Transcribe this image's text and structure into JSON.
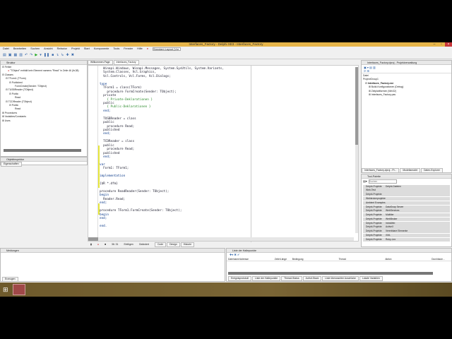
{
  "window": {
    "title": "Interfaces_Factory - Delphi XE3 - Interfaces_Factory"
  },
  "menu": [
    "Datei",
    "Bearbeiten",
    "Suchen",
    "Ansicht",
    "Refactor",
    "Projekt",
    "Start",
    "Komponente",
    "Tools",
    "Fenster",
    "Hilfe"
  ],
  "layout_select": "Standard-Layout (Vor",
  "structure": {
    "title": "Struktur",
    "items": [
      "Fehler",
      "\"TObject\" enthält kein Element namens \"Read\" in Zeile 46 (ltr,38)",
      "Classes",
      "TForm1 (TForm)",
      "Published",
      "FormCreate(Sender: TObject)",
      "TUSBReader (TObject)",
      "Public",
      "Read",
      "TCDReader (TObject)",
      "Public",
      "Read",
      "Procedures",
      "Variables/Constants",
      "Uses"
    ],
    "tab": "Objektinspektor",
    "bottom_tab": "Eigenschaften"
  },
  "editor": {
    "tabs": [
      "Willkommen-Page",
      "Interfaces_Factory"
    ],
    "lines": [
      "  Winapi.Windows, Winapi.Messages, System.SysUtils, System.Variants,",
      "  System.Classes, Vcl.Graphics,",
      "  Vcl.Controls, Vcl.Forms, Vcl.Dialogs;",
      "",
      "type",
      "  TForm1 = class(TForm)",
      "    procedure FormCreate(Sender: TObject);",
      "  private",
      "    { Private-Deklarationen }",
      "  public",
      "    { Public-Deklarationen }",
      "  end;",
      "",
      "  TUSBReader = class",
      "  public",
      "    procedure Read;",
      "  published",
      "  end;",
      "",
      "  TCDReader = class",
      "  public",
      "    procedure Read;",
      "  published",
      "  end;",
      "",
      "var",
      "  Form1: TForm1;",
      "",
      "implementation",
      "",
      "{$R *.dfm}",
      "",
      "procedure ReadReader(Sender: TObject);",
      "begin",
      "  Reader.Read;",
      "end;",
      "",
      "procedure TForm1.FormCreate(Sender: TObject);",
      "begin",
      "end;",
      "",
      "end."
    ],
    "status": {
      "position": "36: 31",
      "mode": "Einfügen",
      "state": "Geändert",
      "tabs": [
        "Code",
        "Design",
        "Historie"
      ]
    }
  },
  "project": {
    "title": "Interfaces_Factory.dproj - Projektverwaltung",
    "header": "Datei",
    "items": [
      "ProjectGroup1",
      "Interfaces_Factory.exe",
      "Build-Konfigurationen (Debug)",
      "Zielplattformen (Win32)",
      "Interfaces_Factory.pas"
    ],
    "tabs": [
      "Interfaces_Factory.dproj - Pr...",
      "Modellansicht",
      "Daten-Explorer"
    ]
  },
  "palette": {
    "title": "Tool-Palette",
    "search_placeholder": "Suchen",
    "items": [
      [
        "Delphi-Projekte",
        "Delphi-Dateien"
      ],
      [
        "Web-Test",
        ""
      ],
      [
        "Delphi-Projekte",
        ""
      ],
      [
        "Webbrokerprojekte",
        ""
      ],
      [
        "Ambient Examples",
        ""
      ],
      [
        "Delphi-Projekte",
        "DataSnap Server"
      ],
      [
        "Delphi-Projekte",
        "WebServices"
      ],
      [
        "Delphi-Projekte",
        "Multitier"
      ],
      [
        "Delphi-Projekte",
        "WebBroker"
      ],
      [
        "Delphi-Projekte",
        "IntraWeb"
      ],
      [
        "Delphi-Projekte",
        "ActiveX"
      ],
      [
        "Delphi-Projekte",
        "Vererbbare Elemente"
      ],
      [
        "Delphi-Projekte",
        "XML"
      ],
      [
        "Delphi-Projekte",
        "Ruby-Lex"
      ]
    ]
  },
  "messages": {
    "title": "Meldungen",
    "tab": "Erzeugen"
  },
  "breakpoints": {
    "title": "Liste der Haltepunkte",
    "columns": [
      "Dateiname/Adresse",
      "Zeile/Länge",
      "Bedingung",
      "Thread",
      "Aktion",
      "Durchlaufz..."
    ],
    "tabs": [
      "Ereignisprotokoll",
      "Liste der Haltepunkte",
      "Thread-Status",
      "Aufruf-Stack",
      "Liste überwachter Ausdrücke",
      "Lokale Variablen"
    ]
  }
}
